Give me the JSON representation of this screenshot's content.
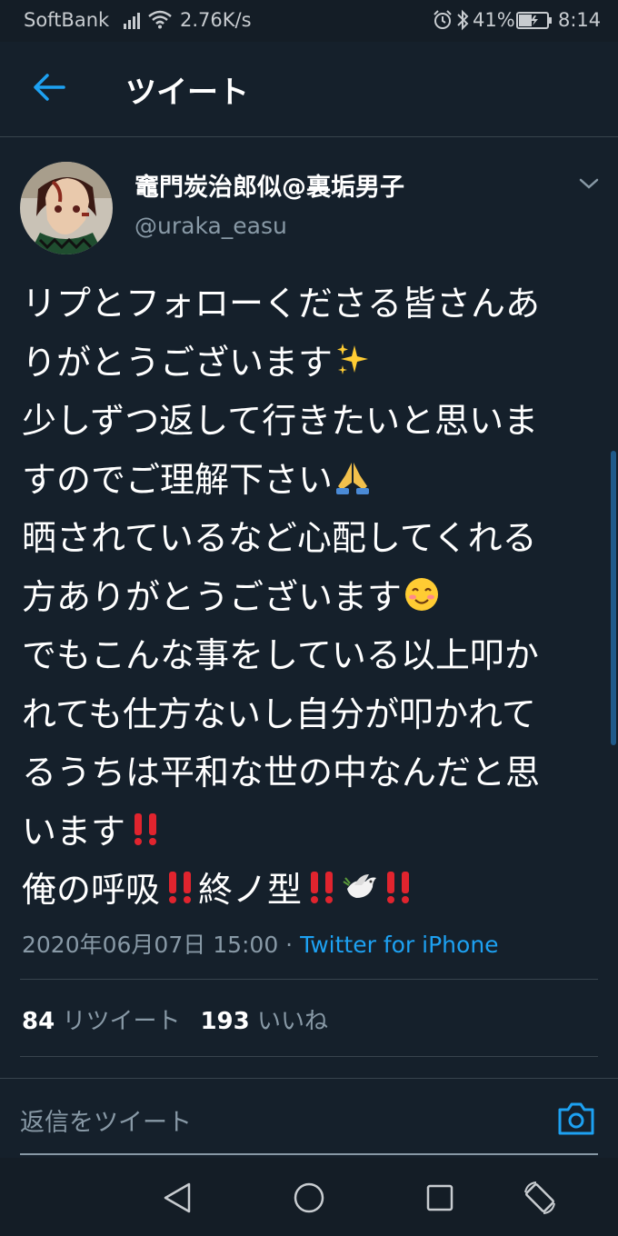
{
  "status_bar": {
    "carrier": "SoftBank",
    "network_speed": "2.76K/s",
    "battery_percent": "41%",
    "time": "8:14"
  },
  "header": {
    "title": "ツイート"
  },
  "tweet": {
    "display_name": "竈門炭治郎似@裏垢男子",
    "handle": "@uraka_easu",
    "body_lines": [
      "リプとフォローくださる皆さんあ",
      "りがとうございます",
      "少しずつ返して行きたいと思いま",
      "すのでご理解下さい",
      "晒されているなど心配してくれる",
      "方ありがとうございます",
      "でもこんな事をしている以上叩か",
      "れても仕方ないし自分が叩かれて",
      "るうちは平和な世の中なんだと思",
      "います",
      "俺の呼吸",
      "終ノ型"
    ],
    "timestamp": "2020年06月07日 15:00 · ",
    "source": "Twitter for iPhone",
    "retweet_count": "84",
    "retweet_label": "リツイート",
    "like_count": "193",
    "like_label": "いいね"
  },
  "reply": {
    "placeholder": "返信をツイート"
  },
  "colors": {
    "background": "#15202b",
    "accent": "#1da1f2",
    "secondary_text": "#8899a6",
    "divider": "#38444d"
  }
}
